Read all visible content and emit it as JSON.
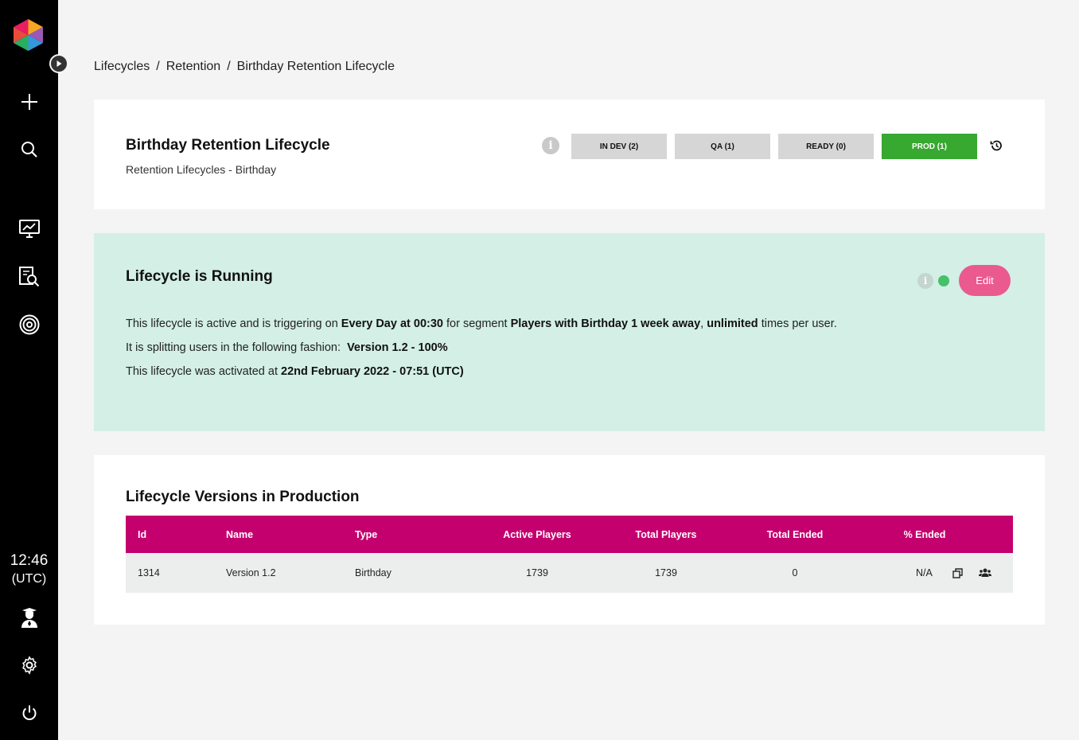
{
  "sidebar": {
    "clock": {
      "time": "12:46",
      "timezone": "(UTC)"
    }
  },
  "breadcrumb": {
    "items": [
      "Lifecycles",
      "Retention",
      "Birthday Retention Lifecycle"
    ],
    "separator": "/"
  },
  "header": {
    "title": "Birthday Retention Lifecycle",
    "subtitle": "Retention Lifecycles - Birthday",
    "stages": [
      {
        "label": "IN DEV (2)",
        "active": false
      },
      {
        "label": "QA (1)",
        "active": false
      },
      {
        "label": "READY (0)",
        "active": false
      },
      {
        "label": "PROD (1)",
        "active": true
      }
    ]
  },
  "status": {
    "title": "Lifecycle is Running",
    "edit_label": "Edit",
    "line1": {
      "pre": "This lifecycle is active and is triggering on ",
      "schedule": "Every Day at 00:30",
      "mid": " for segment ",
      "segment": "Players with Birthday 1 week away",
      "comma": ", ",
      "limit": "unlimited",
      "post": " times per user."
    },
    "line2": {
      "pre": "It is splitting users in the following fashion:  ",
      "split": "Version 1.2 - 100%"
    },
    "line3": {
      "pre": "This lifecycle was activated at ",
      "activated": "22nd February 2022 - 07:51 (UTC)"
    }
  },
  "versions": {
    "title": "Lifecycle Versions in Production",
    "columns": [
      "Id",
      "Name",
      "Type",
      "Active Players",
      "Total Players",
      "Total Ended",
      "% Ended"
    ],
    "rows": [
      {
        "id": "1314",
        "name": "Version 1.2",
        "type": "Birthday",
        "active_players": "1739",
        "total_players": "1739",
        "total_ended": "0",
        "pct_ended": "N/A"
      }
    ]
  },
  "colors": {
    "sidebar_bg": "#000000",
    "prod_active": "#37a830",
    "status_bg": "#d3efe6",
    "edit_button": "#ea5a8e",
    "table_header": "#c4006e"
  }
}
